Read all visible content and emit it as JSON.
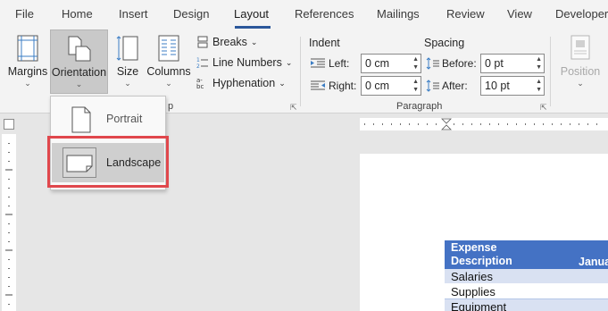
{
  "tabs": [
    "File",
    "Home",
    "Insert",
    "Design",
    "Layout",
    "References",
    "Mailings",
    "Review",
    "View",
    "Developer"
  ],
  "active_tab": "Layout",
  "ribbon": {
    "margins": "Margins",
    "orientation": "Orientation",
    "size": "Size",
    "columns": "Columns",
    "breaks": "Breaks",
    "line_numbers": "Line Numbers",
    "hyphenation": "Hyphenation",
    "page_setup_partial": "p",
    "indent_label": "Indent",
    "spacing_label": "Spacing",
    "left_label": "Left:",
    "right_label": "Right:",
    "before_label": "Before:",
    "after_label": "After:",
    "left_value": "0 cm",
    "right_value": "0 cm",
    "before_value": "0 pt",
    "after_value": "10 pt",
    "paragraph_group": "Paragraph",
    "position": "Position"
  },
  "orientation_menu": {
    "portrait": "Portrait",
    "landscape": "Landscape",
    "selected": "Landscape"
  },
  "table": {
    "header_col1_line1": "Expense",
    "header_col1_line2": "Description",
    "header_col2": "Janua",
    "rows": [
      "Salaries",
      "Supplies",
      "Equipment"
    ]
  },
  "colors": {
    "accent": "#2b579a",
    "table_header": "#4472c4",
    "table_band": "#d9e1f2",
    "highlight": "#e0474c"
  }
}
